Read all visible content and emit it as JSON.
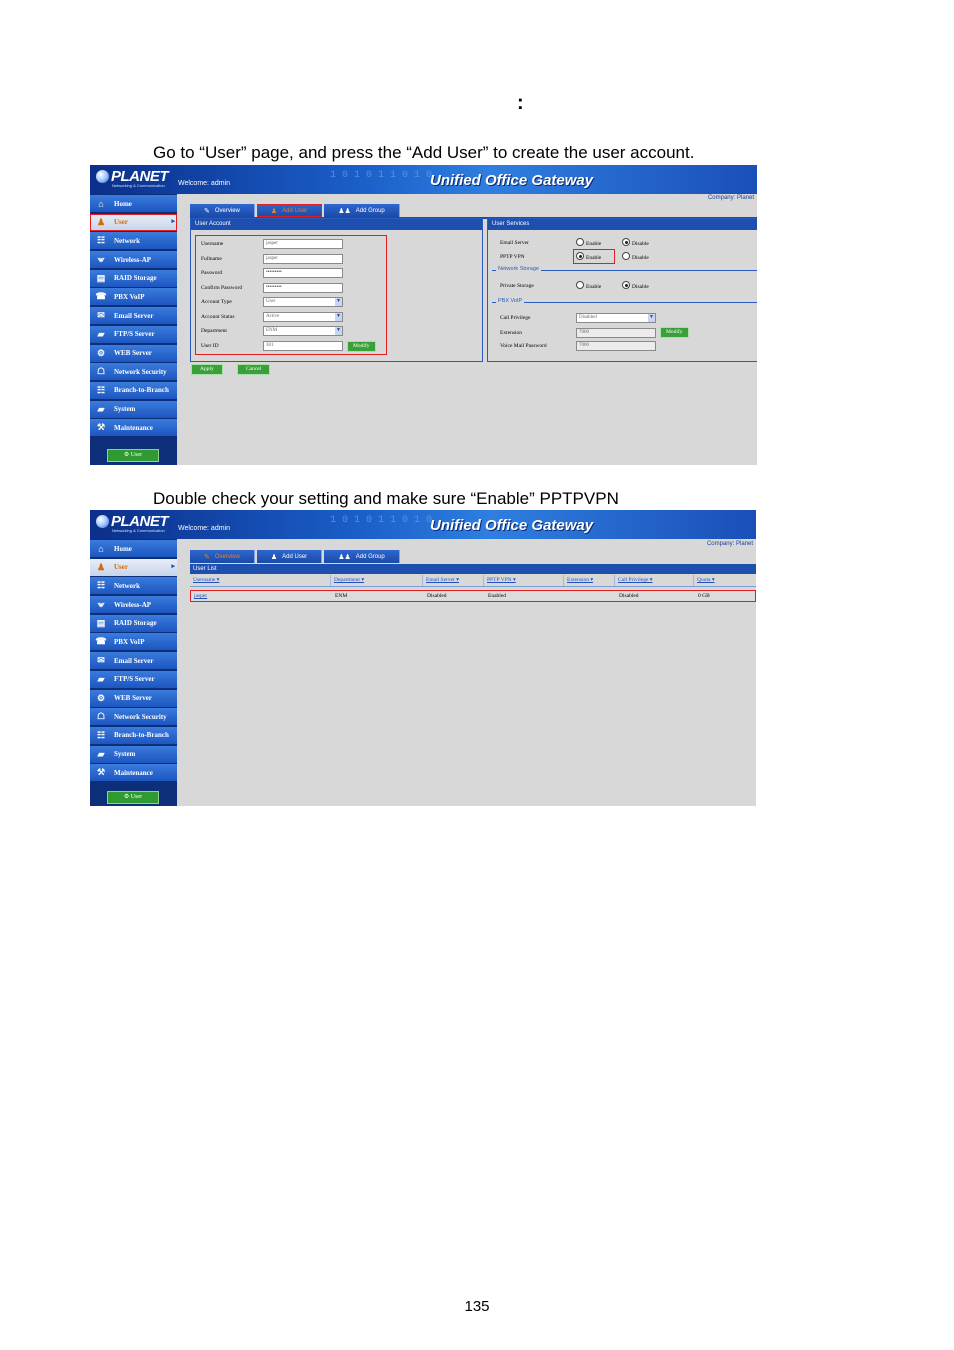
{
  "doc": {
    "colon": ":",
    "instruction1": "Go to “User” page, and press the “Add User” to create the user account.",
    "instruction2": "Double check your setting and make sure “Enable” PPTPVPN",
    "page_number": "135"
  },
  "app": {
    "logo": "PLANET",
    "logo_sub": "Networking & Communication",
    "welcome": "Welcome: admin",
    "title": "Unified Office Gateway",
    "binary_text": "1 0 1 0 1 1 0 1 0",
    "company": "Company: Planet",
    "bottom_button": "User",
    "sidebar": [
      "Home",
      "User",
      "Network",
      "Wireless-AP",
      "RAID Storage",
      "PBX VoIP",
      "Email Server",
      "FTP/S Server",
      "WEB Server",
      "Network Security",
      "Branch-to-Branch",
      "System",
      "Maintenance"
    ],
    "sidebar_icons": [
      "home-icon",
      "user-icon",
      "network-icon",
      "wireless-icon",
      "storage-icon",
      "phone-icon",
      "email-icon",
      "ftp-icon",
      "web-icon",
      "security-icon",
      "branch-icon",
      "system-icon",
      "maintenance-icon"
    ],
    "tabs": [
      "Overview",
      "Add User",
      "Add Group"
    ]
  },
  "shot1": {
    "user_account": {
      "title": "User Account",
      "fields": [
        {
          "label": "Username",
          "value": "jasper",
          "type": "text"
        },
        {
          "label": "Fullname",
          "value": "jasper",
          "type": "text"
        },
        {
          "label": "Password",
          "value": "•••••••••",
          "type": "password"
        },
        {
          "label": "Confirm Password",
          "value": "•••••••••",
          "type": "password"
        },
        {
          "label": "Account Type",
          "value": "User",
          "type": "select"
        },
        {
          "label": "Account Status",
          "value": "Active",
          "type": "select"
        },
        {
          "label": "Department",
          "value": "ENM",
          "type": "select"
        },
        {
          "label": "User ID",
          "value": "301",
          "type": "text"
        }
      ],
      "modify": "Modify"
    },
    "user_services": {
      "title": "User Services",
      "email_label": "Email Server",
      "pptp_label": "PPTP VPN",
      "network_storage_title": "Network Storage",
      "private_storage_label": "Private Storage",
      "pbx_title": "PBX VoIP",
      "call_privilege_label": "Call Privilege",
      "call_privilege_value": "Disabled",
      "extension_label": "Extension",
      "extension_value": "7000",
      "voicemail_label": "Voice Mail Password",
      "voicemail_value": "7000",
      "modify": "Modify",
      "enable": "Enable",
      "disable": "Disable"
    },
    "apply": "Apply",
    "cancel": "Cancel"
  },
  "shot2": {
    "list_title": "User List",
    "columns": [
      "Username ▾",
      "Department ▾",
      "Email Server ▾",
      "PPTP VPN ▾",
      "Extension ▾",
      "Call Privilege ▾",
      "Quota ▾"
    ],
    "row": [
      "jasper",
      "ENM",
      "Disabled",
      "Enabled",
      "",
      "Disabled",
      "0 GB"
    ]
  }
}
